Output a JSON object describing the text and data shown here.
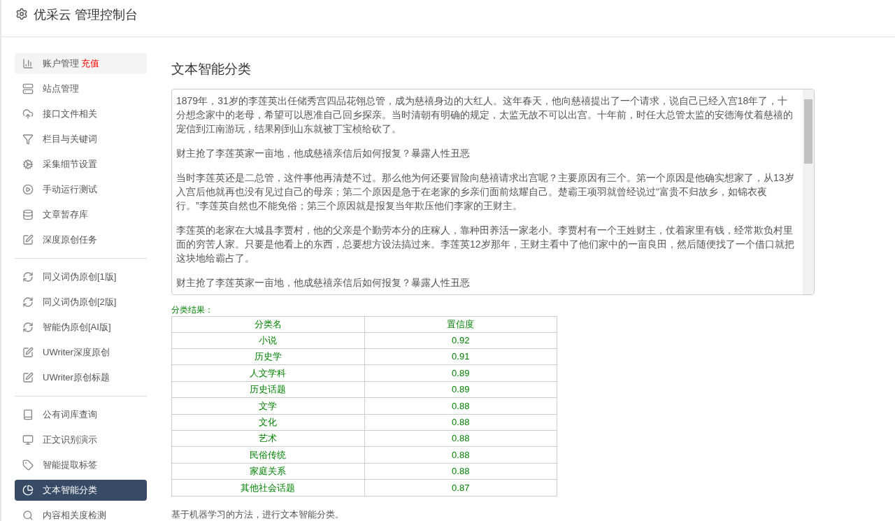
{
  "header": {
    "title": "优采云 管理控制台"
  },
  "sidebar": {
    "groups": [
      [
        {
          "label": "账户管理",
          "badge": "充值",
          "selected": false
        },
        {
          "label": "站点管理",
          "selected": false
        },
        {
          "label": "接口文件相关",
          "selected": false
        },
        {
          "label": "栏目与关键词",
          "selected": false
        },
        {
          "label": "采集细节设置",
          "selected": false
        },
        {
          "label": "手动运行测试",
          "selected": false
        },
        {
          "label": "文章暂存库",
          "selected": false
        },
        {
          "label": "深度原创任务",
          "selected": false
        }
      ],
      [
        {
          "label": "同义词伪原创[1版]",
          "selected": false
        },
        {
          "label": "同义词伪原创[2版]",
          "selected": false
        },
        {
          "label": "智能伪原创[AI版]",
          "selected": false
        },
        {
          "label": "UWriter深度原创",
          "selected": false
        },
        {
          "label": "UWriter原创标题",
          "selected": false
        }
      ],
      [
        {
          "label": "公有词库查询",
          "selected": false
        },
        {
          "label": "正文识别演示",
          "selected": false
        },
        {
          "label": "智能提取标签",
          "selected": false
        },
        {
          "label": "文本智能分类",
          "selected": true
        },
        {
          "label": "内容相关度检测",
          "selected": false
        }
      ]
    ]
  },
  "main": {
    "title": "文本智能分类",
    "input": {
      "paragraphs": [
        "1879年，31岁的李莲英出任储秀宫四品花翎总管，成为慈禧身边的大红人。这年春天，他向慈禧提出了一个请求，说自己已经入宫18年了，十分想念家中的老母，希望可以恩准自己回乡探亲。当时清朝有明确的规定，太监无故不可以出宫。十年前，时任大总管太监的安德海仗着慈禧的宠信到江南游玩，结果刚到山东就被丁宝桢给砍了。",
        "财主抢了李莲英家一亩地，他成慈禧亲信后如何报复？暴露人性丑恶",
        "当时李莲英还是二总管，这件事他再清楚不过。那么他为何还要冒险向慈禧请求出宫呢？主要原因有三个。第一个原因是他确实想家了，从13岁入宫后他就再也没有见过自己的母亲；第二个原因是急于在老家的乡亲们面前炫耀自己。楚霸王项羽就曾经说过“富贵不归故乡，如锦衣夜行。”李莲英自然也不能免俗；第三个原因就是报复当年欺压他们李家的王财主。",
        "李莲英的老家在大城县李贾村，他的父亲是个勤劳本分的庄稼人，靠种田养活一家老小。李贾村有一个王姓财主，仗着家里有钱，经常欺负村里面的穷苦人家。只要是他看上的东西，总要想方设法搞过来。李莲英12岁那年，王财主看中了他们家中的一亩良田，然后随便找了一个借口就把这块地给霸占了。",
        "财主抢了李莲英家一亩地，他成慈禧亲信后如何报复？暴露人性丑恶"
      ]
    },
    "result_label": "分类结果：",
    "table": {
      "columns": [
        "分类名",
        "置信度"
      ],
      "rows": [
        [
          "小说",
          "0.92"
        ],
        [
          "历史学",
          "0.91"
        ],
        [
          "人文学科",
          "0.89"
        ],
        [
          "历史话题",
          "0.89"
        ],
        [
          "文学",
          "0.88"
        ],
        [
          "文化",
          "0.88"
        ],
        [
          "艺术",
          "0.88"
        ],
        [
          "民俗传统",
          "0.88"
        ],
        [
          "家庭关系",
          "0.88"
        ],
        [
          "其他社会话题",
          "0.87"
        ]
      ]
    },
    "note": "基于机器学习的方法，进行文本智能分类。"
  }
}
